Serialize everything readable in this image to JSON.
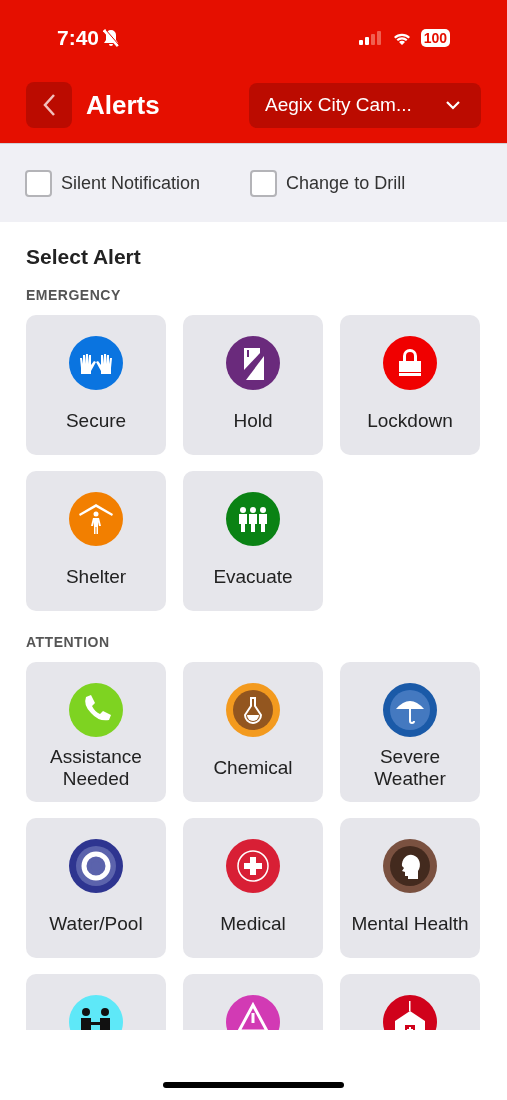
{
  "status_bar": {
    "time": "7:40",
    "silenced": true,
    "battery": "100"
  },
  "nav": {
    "title": "Alerts",
    "campus": "Aegix City Cam..."
  },
  "options": [
    {
      "label": "Silent Notification",
      "checked": false
    },
    {
      "label": "Change to Drill",
      "checked": false
    }
  ],
  "heading": "Select Alert",
  "sections": [
    {
      "title": "EMERGENCY",
      "alerts": [
        {
          "label": "Secure",
          "kind": "hands",
          "color": "#0a74e0"
        },
        {
          "label": "Hold",
          "kind": "door",
          "color": "#6a2a7c"
        },
        {
          "label": "Lockdown",
          "kind": "lock",
          "color": "#f00000"
        },
        {
          "label": "Shelter",
          "kind": "shelter",
          "color": "#f27f00"
        },
        {
          "label": "Evacuate",
          "kind": "people",
          "color": "#0a8214"
        }
      ]
    },
    {
      "title": "ATTENTION",
      "alerts": [
        {
          "label": "Assistance Needed",
          "kind": "phone",
          "color": "#7ed321"
        },
        {
          "label": "Chemical",
          "kind": "flask",
          "color": "#f39a1e"
        },
        {
          "label": "Severe Weather",
          "kind": "umbrella",
          "color": "#1a5aa8"
        },
        {
          "label": "Water/Pool",
          "kind": "ring",
          "color": "#2e3590"
        },
        {
          "label": "Medical",
          "kind": "cross",
          "color": "#d81f35"
        },
        {
          "label": "Mental Health",
          "kind": "head",
          "color": "#7a5140"
        },
        {
          "kind": "talk",
          "color": "#5ee8f8"
        },
        {
          "kind": "warning",
          "color": "#d23ab4"
        },
        {
          "kind": "school",
          "color": "#d0021b"
        }
      ]
    }
  ]
}
